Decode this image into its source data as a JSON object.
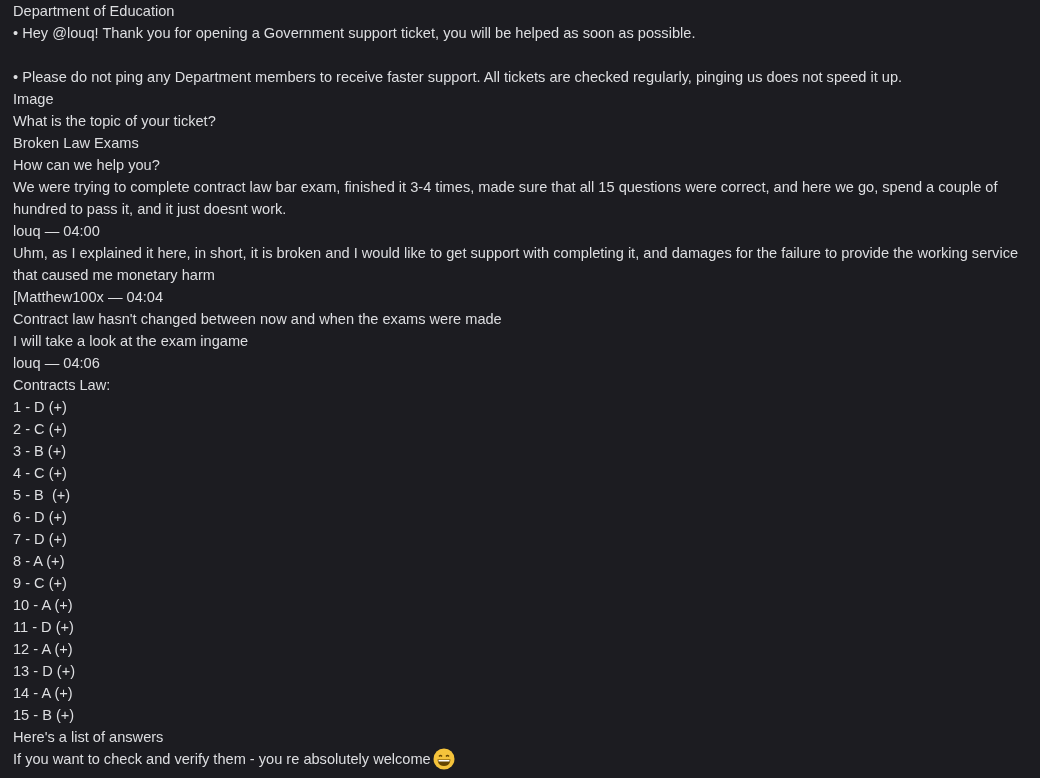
{
  "lines": [
    {
      "kind": "text",
      "text": "Department of Education"
    },
    {
      "kind": "text",
      "text": "• Hey @louq! Thank you for opening a Government support ticket, you will be helped as soon as possible."
    },
    {
      "kind": "spacer"
    },
    {
      "kind": "text",
      "text": "• Please do not ping any Department members to receive faster support. All tickets are checked regularly, pinging us does not speed it up."
    },
    {
      "kind": "text",
      "text": "Image"
    },
    {
      "kind": "text",
      "text": "What is the topic of your ticket?"
    },
    {
      "kind": "text",
      "text": "Broken Law Exams"
    },
    {
      "kind": "text",
      "text": "How can we help you?"
    },
    {
      "kind": "text",
      "text": "We were trying to complete contract law bar exam, finished it 3-4 times, made sure that all 15 questions were correct, and here we go, spend a couple of hundred to pass it, and it just doesnt work."
    },
    {
      "kind": "text",
      "text": "louq — 04:00"
    },
    {
      "kind": "text",
      "text": "Uhm, as I explained it here, in short, it is broken and I would like to get support with completing it, and damages for the failure to provide the working service that caused me monetary harm"
    },
    {
      "kind": "text",
      "text": "[Matthew100x — 04:04"
    },
    {
      "kind": "text",
      "text": "Contract law hasn't changed between now and when the exams were made"
    },
    {
      "kind": "text",
      "text": "I will take a look at the exam ingame"
    },
    {
      "kind": "text",
      "text": "louq — 04:06"
    },
    {
      "kind": "text",
      "text": "Contracts Law:"
    },
    {
      "kind": "text",
      "text": "1 - D (+)"
    },
    {
      "kind": "text",
      "text": "2 - C (+)"
    },
    {
      "kind": "text",
      "text": "3 - B (+)"
    },
    {
      "kind": "text",
      "text": "4 - C (+)"
    },
    {
      "kind": "text",
      "text": "5 - B  (+)"
    },
    {
      "kind": "text",
      "text": "6 - D (+)"
    },
    {
      "kind": "text",
      "text": "7 - D (+)"
    },
    {
      "kind": "text",
      "text": "8 - A (+)"
    },
    {
      "kind": "text",
      "text": "9 - C (+)"
    },
    {
      "kind": "text",
      "text": "10 - A (+)"
    },
    {
      "kind": "text",
      "text": "11 - D (+)"
    },
    {
      "kind": "text",
      "text": "12 - A (+)"
    },
    {
      "kind": "text",
      "text": "13 - D (+)"
    },
    {
      "kind": "text",
      "text": "14 - A (+)"
    },
    {
      "kind": "text",
      "text": "15 - B (+)"
    },
    {
      "kind": "text",
      "text": "Here's a list of answers"
    },
    {
      "kind": "emoji_text",
      "text": "If you want to check and verify them - you re absolutely welcome"
    }
  ]
}
